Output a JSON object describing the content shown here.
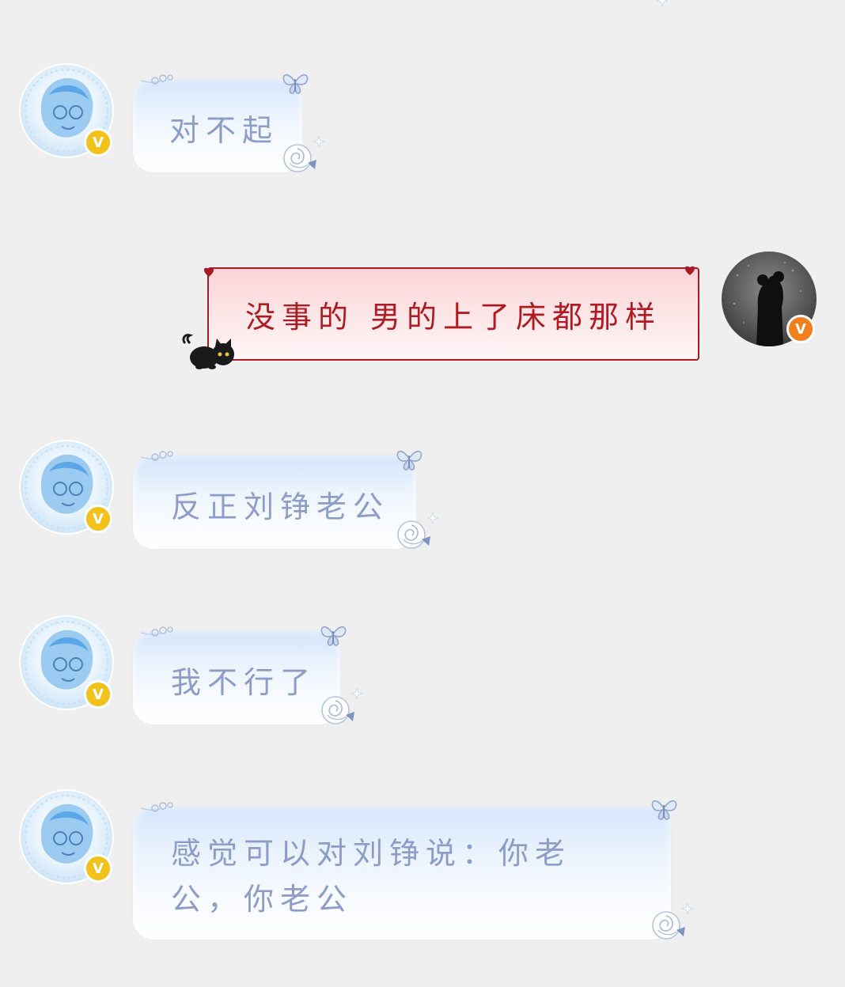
{
  "messages": [
    {
      "side": "left",
      "text": "对不起"
    },
    {
      "side": "right",
      "text": "没事的 男的上了床都那样"
    },
    {
      "side": "left",
      "text": "反正刘铮老公"
    },
    {
      "side": "left",
      "text": "我不行了"
    },
    {
      "side": "left",
      "text": "感觉可以对刘铮说：你老公，你老公"
    }
  ],
  "badge_letter": "V",
  "colors": {
    "background": "#efefef",
    "left_text": "#8d9cc8",
    "right_text": "#b01a22",
    "badge_yellow": "#f3c21a",
    "badge_orange": "#f07f1c"
  },
  "icons": [
    "butterfly-icon",
    "rose-icon",
    "sparkle-icon",
    "heart-icon",
    "black-cat-icon",
    "verified-badge-icon"
  ]
}
